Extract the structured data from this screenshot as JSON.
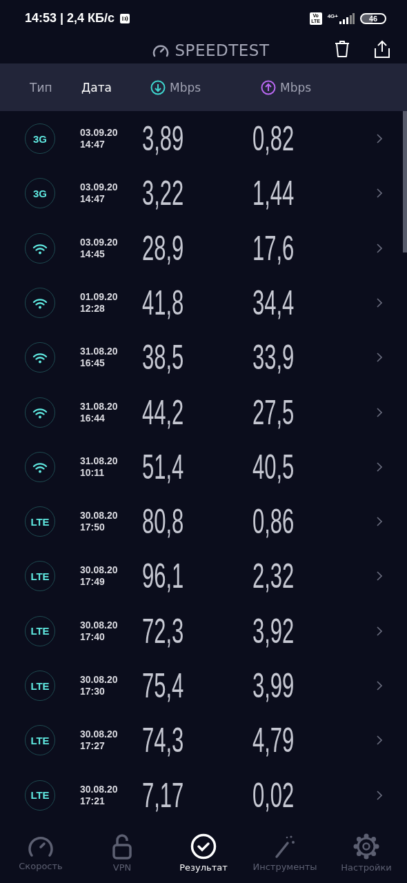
{
  "status_bar": {
    "time": "14:53 | 2,4 КБ/с",
    "volte": "Vo LTE",
    "network": "4G+",
    "battery": "46"
  },
  "app_bar": {
    "title": "SPEEDTEST"
  },
  "columns": [
    {
      "label": "Тип",
      "kind": "text",
      "selected": false
    },
    {
      "label": "Дата",
      "kind": "text",
      "selected": true
    },
    {
      "label": "Mbps",
      "kind": "download",
      "selected": false
    },
    {
      "label": "Mbps",
      "kind": "upload",
      "selected": false
    }
  ],
  "results": [
    {
      "kind": "umts",
      "type": "3G",
      "date": "03.09.20",
      "time": "14:47",
      "download": "3,89",
      "upload": "0,82"
    },
    {
      "kind": "umts",
      "type": "3G",
      "date": "03.09.20",
      "time": "14:47",
      "download": "3,22",
      "upload": "1,44"
    },
    {
      "kind": "wifi",
      "date": "03.09.20",
      "time": "14:45",
      "download": "28,9",
      "upload": "17,6"
    },
    {
      "kind": "wifi",
      "date": "01.09.20",
      "time": "12:28",
      "download": "41,8",
      "upload": "34,4"
    },
    {
      "kind": "wifi",
      "date": "31.08.20",
      "time": "16:45",
      "download": "38,5",
      "upload": "33,9"
    },
    {
      "kind": "wifi",
      "date": "31.08.20",
      "time": "16:44",
      "download": "44,2",
      "upload": "27,5"
    },
    {
      "kind": "wifi",
      "date": "31.08.20",
      "time": "10:11",
      "download": "51,4",
      "upload": "40,5"
    },
    {
      "kind": "lte",
      "type": "LTE",
      "date": "30.08.20",
      "time": "17:50",
      "download": "80,8",
      "upload": "0,86"
    },
    {
      "kind": "lte",
      "type": "LTE",
      "date": "30.08.20",
      "time": "17:49",
      "download": "96,1",
      "upload": "2,32"
    },
    {
      "kind": "lte",
      "type": "LTE",
      "date": "30.08.20",
      "time": "17:40",
      "download": "72,3",
      "upload": "3,92"
    },
    {
      "kind": "lte",
      "type": "LTE",
      "date": "30.08.20",
      "time": "17:30",
      "download": "75,4",
      "upload": "3,99"
    },
    {
      "kind": "lte",
      "type": "LTE",
      "date": "30.08.20",
      "time": "17:27",
      "download": "74,3",
      "upload": "4,79"
    },
    {
      "kind": "lte",
      "type": "LTE",
      "date": "30.08.20",
      "time": "17:21",
      "download": "7,17",
      "upload": "0,02"
    }
  ],
  "bottom_nav": [
    {
      "kind": "speed",
      "label": "Скорость",
      "selected": false
    },
    {
      "kind": "lock",
      "label": "VPN",
      "selected": false
    },
    {
      "kind": "check",
      "label": "Результат",
      "selected": true
    },
    {
      "kind": "wand",
      "label": "Инструменты",
      "selected": false
    },
    {
      "kind": "gear",
      "label": "Настройки",
      "selected": false
    }
  ]
}
